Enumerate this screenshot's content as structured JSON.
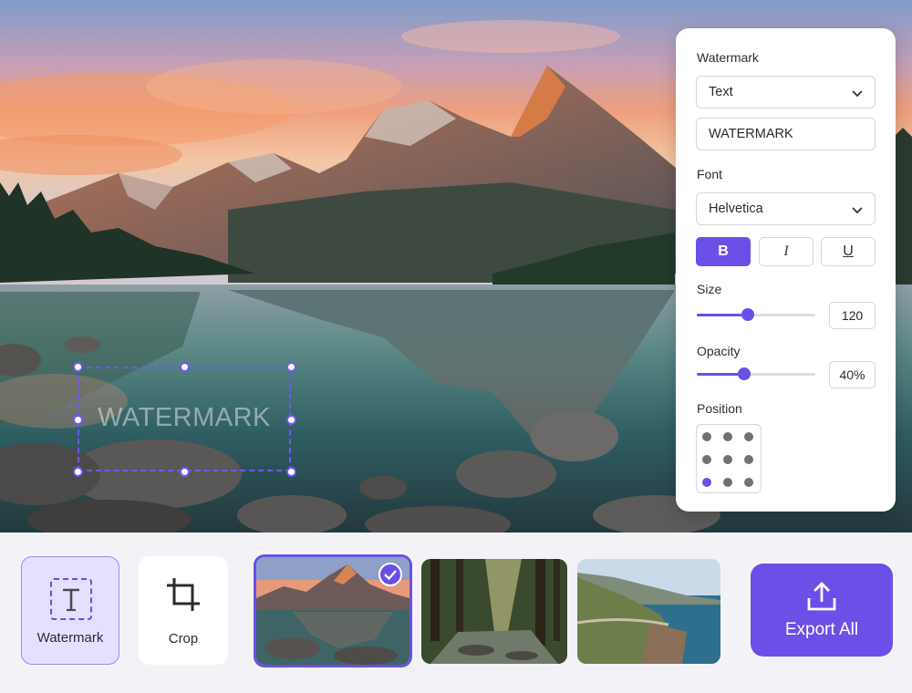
{
  "canvas": {
    "watermark_overlay_text": "WATERMARK"
  },
  "panel": {
    "watermark_label": "Watermark",
    "watermark_type": "Text",
    "watermark_text": "WATERMARK",
    "font_label": "Font",
    "font_value": "Helvetica",
    "format_buttons": {
      "bold": "B",
      "italic": "I",
      "underline": "U"
    },
    "bold_active": true,
    "size_label": "Size",
    "size_value": "120",
    "size_level": 0.43,
    "opacity_label": "Opacity",
    "opacity_value": "40%",
    "opacity_level": 0.4,
    "position_label": "Position",
    "position_selected": "bottom-left"
  },
  "toolbar": {
    "tools": [
      {
        "label": "Watermark",
        "icon": "text-icon",
        "active": true
      },
      {
        "label": "Crop",
        "icon": "crop-icon",
        "active": false
      }
    ],
    "thumbnails": [
      {
        "scene": "mountain-lake",
        "selected": true
      },
      {
        "scene": "forest-stream",
        "selected": false
      },
      {
        "scene": "coastal-road",
        "selected": false
      }
    ],
    "export_label": "Export All",
    "export_icon": "upload-icon"
  },
  "colors": {
    "accent": "#6b4fe6",
    "panel_bg": "#ffffff",
    "toolbar_bg": "#f3f3f7"
  }
}
